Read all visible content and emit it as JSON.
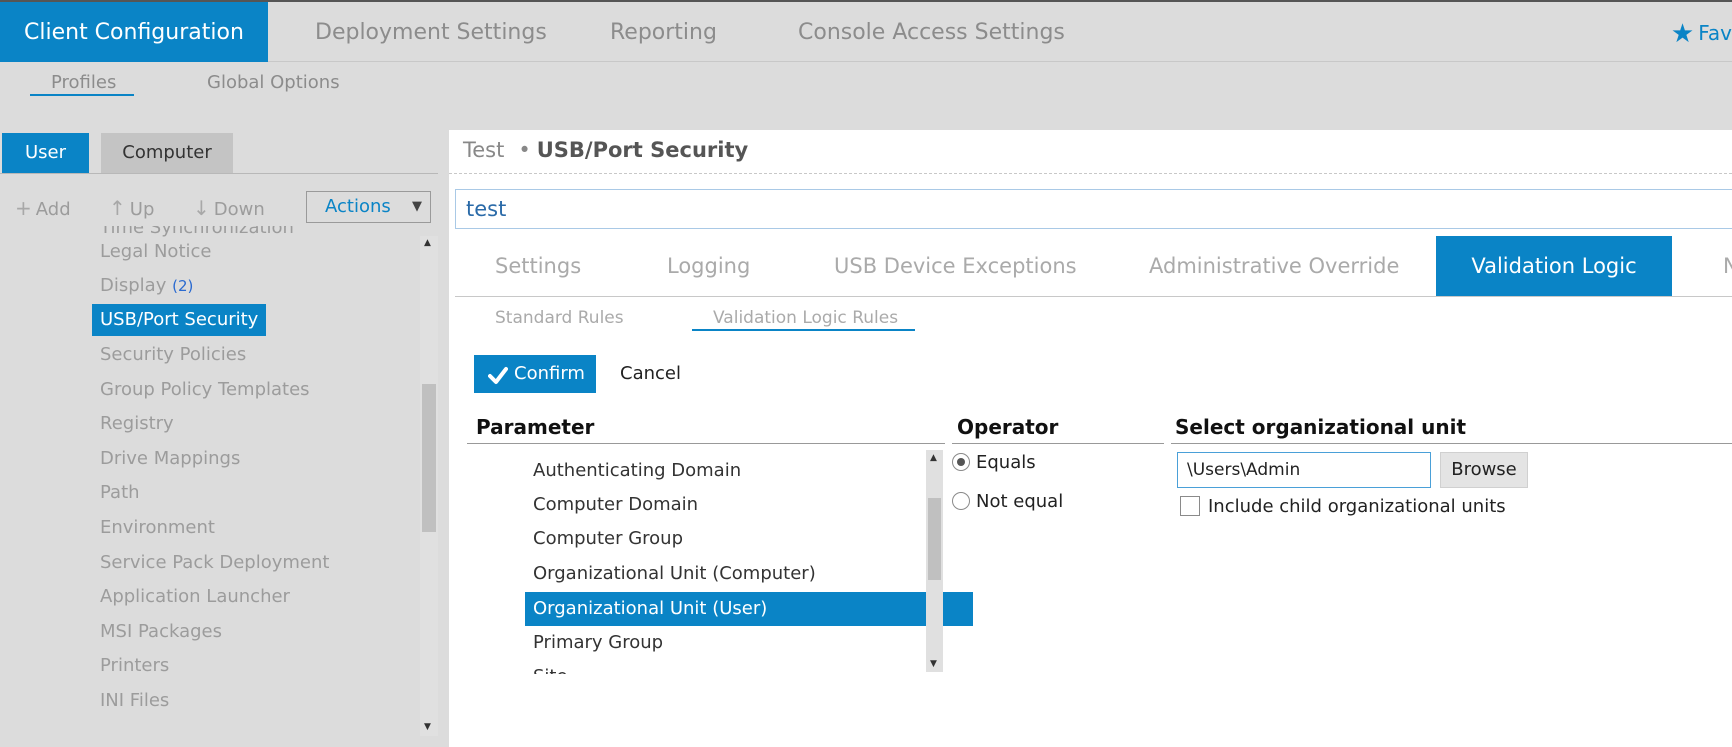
{
  "top_nav": {
    "tabs": [
      "Client Configuration",
      "Deployment Settings",
      "Reporting",
      "Console Access Settings"
    ],
    "active_tab": "Client Configuration",
    "favorites_label": "Fav"
  },
  "sub_nav": {
    "items": [
      "Profiles",
      "Global Options"
    ],
    "active": "Profiles"
  },
  "left_panel": {
    "tabs": [
      "User",
      "Computer"
    ],
    "active_tab": "User",
    "toolbar": {
      "add_label": "Add",
      "up_label": "Up",
      "down_label": "Down",
      "actions_label": "Actions"
    },
    "items": [
      {
        "label": "Time Synchronization"
      },
      {
        "label": "Legal Notice"
      },
      {
        "label": "Display",
        "count": "(2)"
      },
      {
        "label": "USB/Port Security"
      },
      {
        "label": "Security Policies"
      },
      {
        "label": "Group Policy Templates"
      },
      {
        "label": "Registry"
      },
      {
        "label": "Drive Mappings"
      },
      {
        "label": "Path"
      },
      {
        "label": "Environment"
      },
      {
        "label": "Service Pack Deployment"
      },
      {
        "label": "Application Launcher"
      },
      {
        "label": "MSI Packages"
      },
      {
        "label": "Printers"
      },
      {
        "label": "INI Files"
      }
    ],
    "selected_item": "USB/Port Security"
  },
  "main": {
    "breadcrumb": {
      "profile": "Test",
      "separator": "•",
      "section": "USB/Port Security"
    },
    "name_value": "test",
    "tabs": [
      "Settings",
      "Logging",
      "USB Device Exceptions",
      "Administrative Override",
      "Validation Logic",
      "N"
    ],
    "active_tab": "Validation Logic",
    "subtabs": [
      "Standard Rules",
      "Validation Logic Rules"
    ],
    "active_subtab": "Validation Logic Rules",
    "confirm_label": "Confirm",
    "cancel_label": "Cancel",
    "parameter": {
      "header": "Parameter",
      "items": [
        "Authenticating Domain",
        "Computer Domain",
        "Computer Group",
        "Organizational Unit (Computer)",
        "Organizational Unit (User)",
        "Primary Group",
        "Site"
      ],
      "selected": "Organizational Unit (User)"
    },
    "operator": {
      "header": "Operator",
      "options": [
        "Equals",
        "Not equal"
      ],
      "selected": "Equals"
    },
    "ou": {
      "header": "Select organizational unit",
      "value": "\\Users\\Admin",
      "browse_label": "Browse",
      "include_child_label": "Include child organizational units",
      "include_child_checked": false
    }
  },
  "colors": {
    "accent": "#0a84c6",
    "background": "#dcdcdc"
  }
}
